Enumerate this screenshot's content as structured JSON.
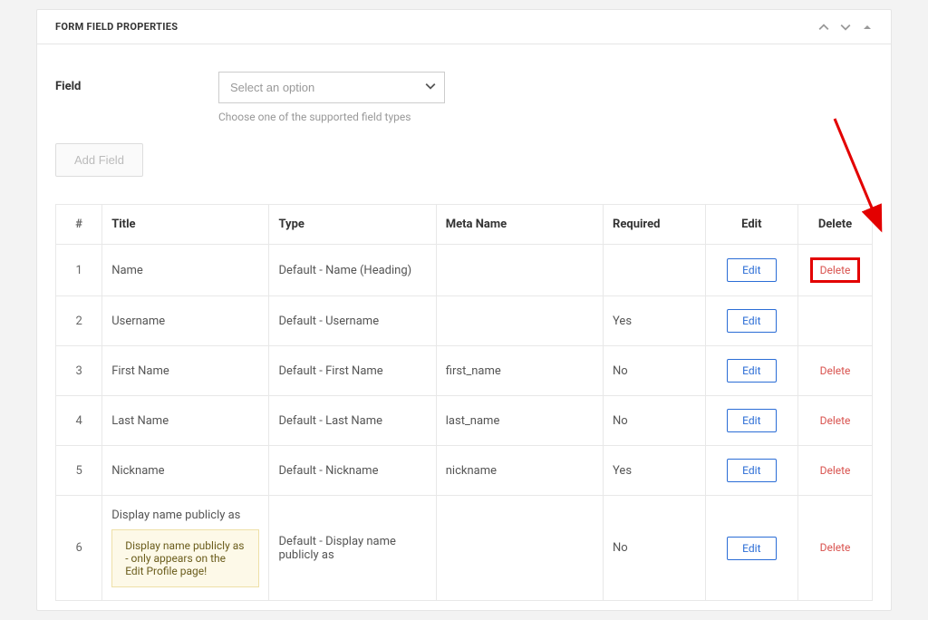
{
  "panel": {
    "title": "FORM FIELD PROPERTIES"
  },
  "field_selector": {
    "label": "Field",
    "placeholder": "Select an option",
    "help": "Choose one of the supported field types"
  },
  "add_field_btn": "Add Field",
  "table": {
    "headers": {
      "num": "#",
      "title": "Title",
      "type": "Type",
      "meta": "Meta Name",
      "required": "Required",
      "edit": "Edit",
      "delete": "Delete"
    },
    "action_labels": {
      "edit": "Edit",
      "delete": "Delete"
    },
    "rows": [
      {
        "num": "1",
        "title": "Name",
        "type": "Default - Name (Heading)",
        "meta": "",
        "required": "",
        "note": "",
        "deletable": true,
        "delete_highlight": true
      },
      {
        "num": "2",
        "title": "Username",
        "type": "Default - Username",
        "meta": "",
        "required": "Yes",
        "note": "",
        "deletable": false
      },
      {
        "num": "3",
        "title": "First Name",
        "type": "Default - First Name",
        "meta": "first_name",
        "required": "No",
        "note": "",
        "deletable": true
      },
      {
        "num": "4",
        "title": "Last Name",
        "type": "Default - Last Name",
        "meta": "last_name",
        "required": "No",
        "note": "",
        "deletable": true
      },
      {
        "num": "5",
        "title": "Nickname",
        "type": "Default - Nickname",
        "meta": "nickname",
        "required": "Yes",
        "note": "",
        "deletable": true
      },
      {
        "num": "6",
        "title": "Display name publicly as",
        "type": "Default - Display name publicly as",
        "meta": "",
        "required": "No",
        "note": "Display name publicly as - only appears on the Edit Profile page!",
        "deletable": true
      }
    ]
  }
}
